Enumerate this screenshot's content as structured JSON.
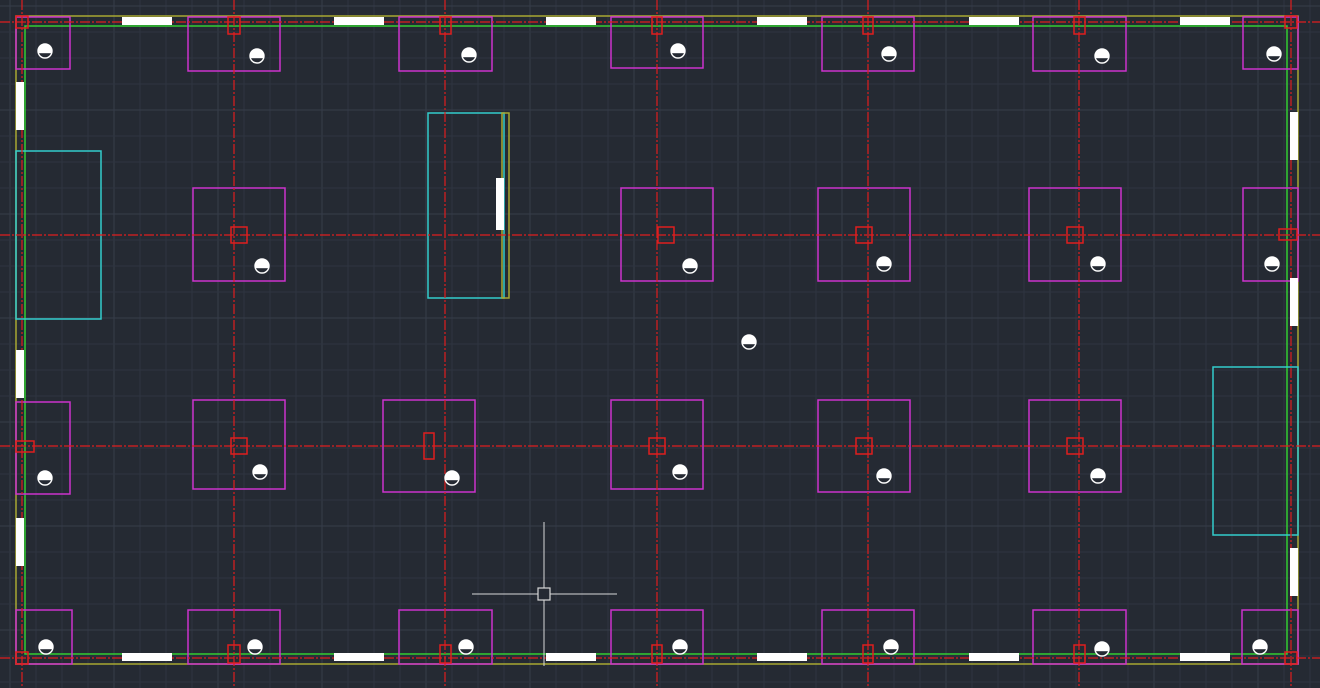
{
  "viewport": {
    "background": "#252a33",
    "colors": {
      "grid_minor": "#2e3440",
      "grid_major": "#363d4a",
      "axis_line": "#e01e1e",
      "column_marker": "#e01e1e",
      "footing": "#cc33cc",
      "opening": "#33cccc",
      "boundary_outer": "#a8a832",
      "boundary_inner": "#33cc33",
      "wall_gap": "#ffffff",
      "pile_symbol": "#ffffff",
      "crosshair": "#d8d8d8"
    }
  },
  "layers": {
    "grid": "grid",
    "axis": "axis-lines",
    "footing": "footings",
    "opening": "openings",
    "marker": "column-markers",
    "pile": "pile-symbols",
    "boundary": "slab-boundary",
    "gap": "wall-openings"
  },
  "cursor": {
    "name": "crosshair-cursor"
  }
}
